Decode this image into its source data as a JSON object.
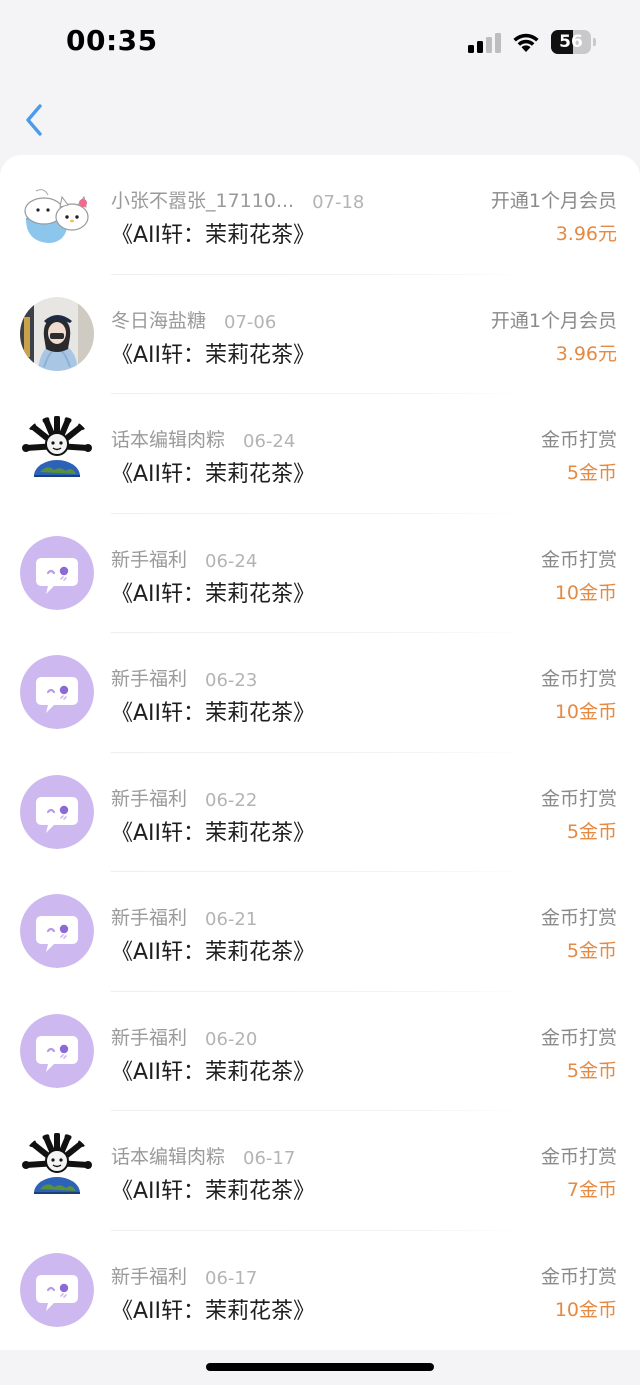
{
  "status_bar": {
    "time": "00:35",
    "battery": "56",
    "battery_level_percent": 56
  },
  "nav": {
    "back_icon": "chevron-left-icon",
    "accent_color": "#4a9bea"
  },
  "colors": {
    "amount": "#e58a43",
    "welfare_avatar": "#cdb8f0",
    "title": "#1e1e1e",
    "secondary": "#9a9a9a"
  },
  "records": [
    {
      "sender": "小张不嚣张_17110...",
      "date": "07-18",
      "book": "《AII轩：茉莉花茶》",
      "type": "开通1个月会员",
      "amount": "3.96元",
      "avatar": "hello-kitty-avatar"
    },
    {
      "sender": "冬日海盐糖",
      "date": "07-06",
      "book": "《AII轩：茉莉花茶》",
      "type": "开通1个月会员",
      "amount": "3.96元",
      "avatar": "portrait-photo-avatar"
    },
    {
      "sender": "话本编辑肉粽",
      "date": "06-24",
      "book": "《AII轩：茉莉花茶》",
      "type": "金币打赏",
      "amount": "5金币",
      "avatar": "globe-cartoon-avatar"
    },
    {
      "sender": "新手福利",
      "date": "06-24",
      "book": "《AII轩：茉莉花茶》",
      "type": "金币打赏",
      "amount": "10金币",
      "avatar": "chat-bubble-avatar"
    },
    {
      "sender": "新手福利",
      "date": "06-23",
      "book": "《AII轩：茉莉花茶》",
      "type": "金币打赏",
      "amount": "10金币",
      "avatar": "chat-bubble-avatar"
    },
    {
      "sender": "新手福利",
      "date": "06-22",
      "book": "《AII轩：茉莉花茶》",
      "type": "金币打赏",
      "amount": "5金币",
      "avatar": "chat-bubble-avatar"
    },
    {
      "sender": "新手福利",
      "date": "06-21",
      "book": "《AII轩：茉莉花茶》",
      "type": "金币打赏",
      "amount": "5金币",
      "avatar": "chat-bubble-avatar"
    },
    {
      "sender": "新手福利",
      "date": "06-20",
      "book": "《AII轩：茉莉花茶》",
      "type": "金币打赏",
      "amount": "5金币",
      "avatar": "chat-bubble-avatar"
    },
    {
      "sender": "话本编辑肉粽",
      "date": "06-17",
      "book": "《AII轩：茉莉花茶》",
      "type": "金币打赏",
      "amount": "7金币",
      "avatar": "globe-cartoon-avatar"
    },
    {
      "sender": "新手福利",
      "date": "06-17",
      "book": "《AII轩：茉莉花茶》",
      "type": "金币打赏",
      "amount": "10金币",
      "avatar": "chat-bubble-avatar"
    }
  ]
}
